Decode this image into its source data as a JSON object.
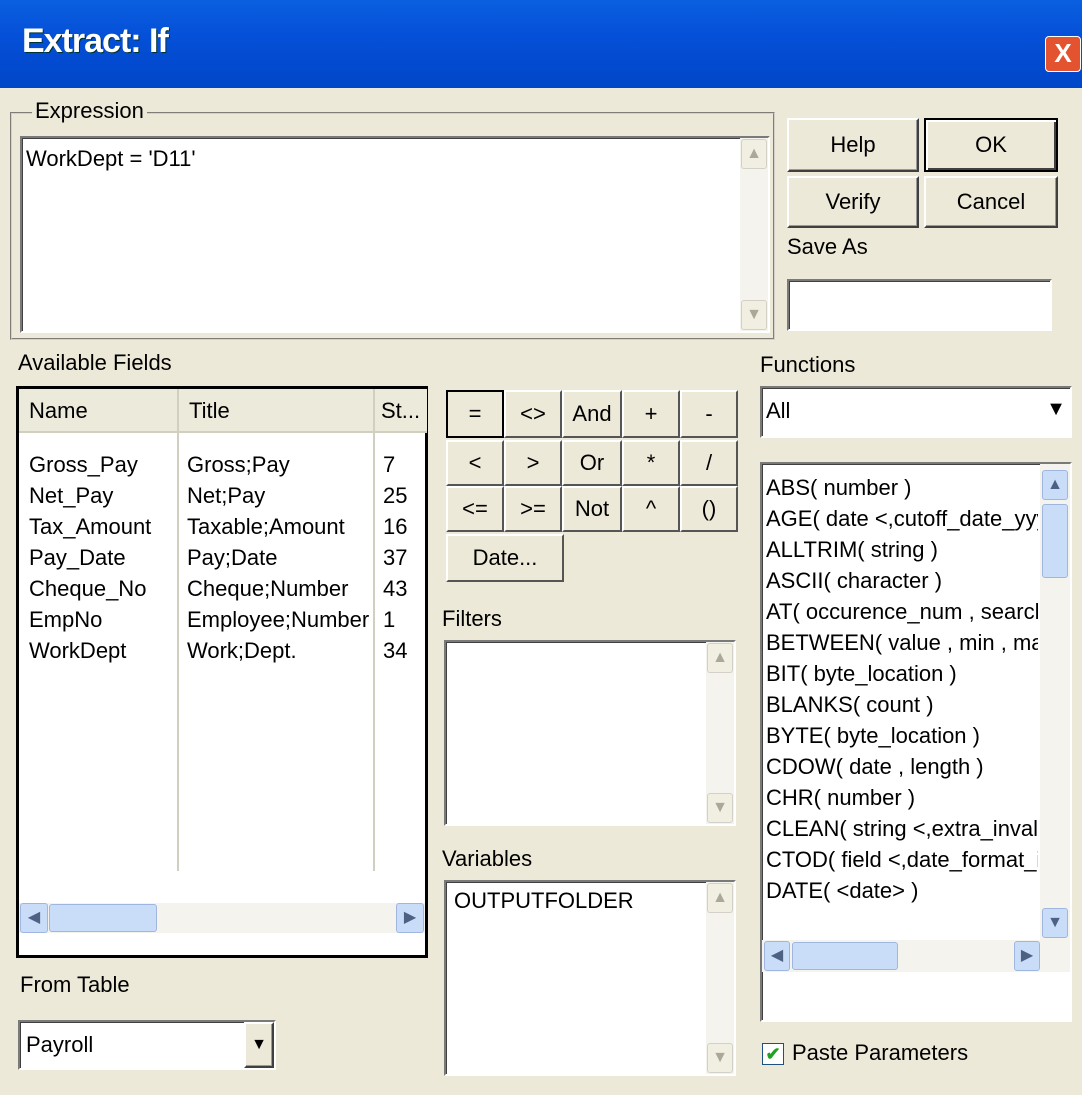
{
  "window": {
    "title": "Extract: If",
    "close_glyph": "X"
  },
  "expression": {
    "group_label": "Expression",
    "value": "WorkDept = 'D11'"
  },
  "buttons": {
    "help": "Help",
    "ok": "OK",
    "verify": "Verify",
    "cancel": "Cancel",
    "save_as_label": "Save As",
    "save_as_value": ""
  },
  "available_fields": {
    "label": "Available Fields",
    "columns": [
      "Name",
      "Title",
      "St..."
    ],
    "rows": [
      [
        "Gross_Pay",
        "Gross;Pay",
        "7"
      ],
      [
        "Net_Pay",
        "Net;Pay",
        "25"
      ],
      [
        "Tax_Amount",
        "Taxable;Amount",
        "16"
      ],
      [
        "Pay_Date",
        "Pay;Date",
        "37"
      ],
      [
        "Cheque_No",
        "Cheque;Number",
        "43"
      ],
      [
        "EmpNo",
        "Employee;Number",
        "1"
      ],
      [
        "WorkDept",
        "Work;Dept.",
        "34"
      ]
    ]
  },
  "operators": {
    "row1": [
      "=",
      "<>",
      "And",
      "+",
      "-"
    ],
    "row2": [
      "<",
      ">",
      "Or",
      "*",
      "/"
    ],
    "row3": [
      "<=",
      ">=",
      "Not",
      "^",
      "()"
    ],
    "date": "Date..."
  },
  "filters": {
    "label": "Filters",
    "items": []
  },
  "variables": {
    "label": "Variables",
    "items": [
      "OUTPUTFOLDER"
    ]
  },
  "from_table": {
    "label": "From Table",
    "value": "Payroll"
  },
  "functions": {
    "label": "Functions",
    "category": "All",
    "items": [
      "ABS( number )",
      "AGE( date <,cutoff_date_yyyym",
      "ALLTRIM( string )",
      "ASCII( character )",
      "AT( occurence_num , search_fo",
      "BETWEEN( value , min , max )",
      "BIT( byte_location )",
      "BLANKS( count )",
      "BYTE( byte_location )",
      "CDOW( date , length )",
      "CHR( number )",
      "CLEAN( string <,extra_invalid_c",
      "CTOD( field <,date_format_if_nc",
      "DATE( <date> )"
    ]
  },
  "paste_parameters": {
    "label": "Paste Parameters",
    "checked": true
  },
  "colors": {
    "titlebar": "#0550d8",
    "dialog": "#ece9d8",
    "close": "#e4532f"
  }
}
